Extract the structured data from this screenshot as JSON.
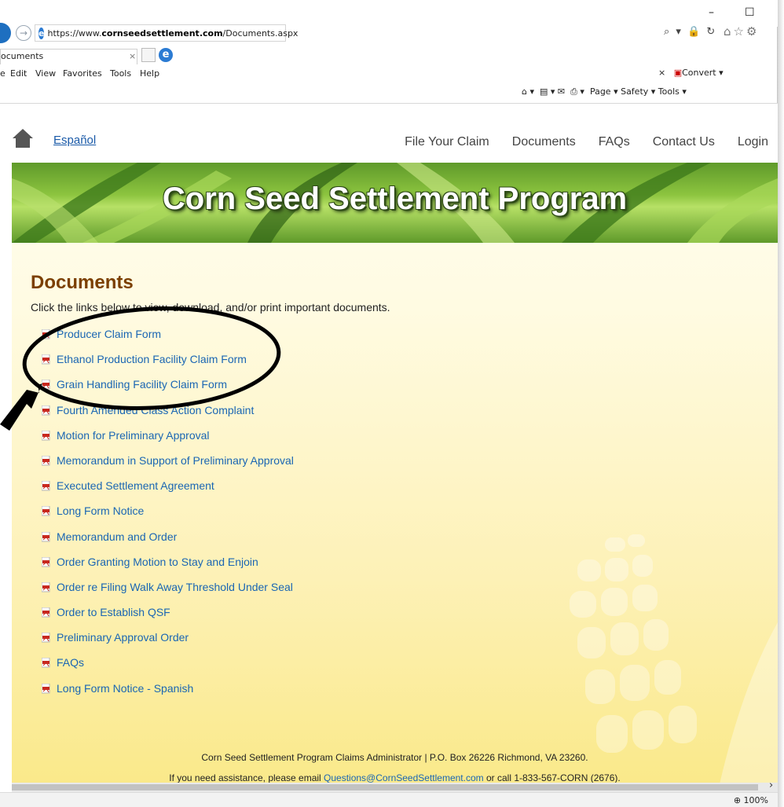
{
  "browser": {
    "url_prefix": "https://www.",
    "url_domain": "cornseedsettlement.com",
    "url_path": "/Documents.aspx",
    "address_right_icons": "⌕ ▾ 🔒 ↻",
    "tab_title": "ocuments",
    "tab_close": "×",
    "window_min": "–",
    "window_max": "☐",
    "menu": [
      "e",
      "Edit",
      "View",
      "Favorites",
      "Tools",
      "Help"
    ],
    "convert_close": "×",
    "convert_label": "Convert",
    "command_bar": "Page ▾   Safety ▾   Tools ▾",
    "zoom": "100%"
  },
  "site": {
    "espanol": "Español",
    "nav": [
      "File Your Claim",
      "Documents",
      "FAQs",
      "Contact Us",
      "Login"
    ],
    "banner_title": "Corn Seed Settlement Program"
  },
  "content": {
    "heading": "Documents",
    "intro": "Click the links below to view, download, and/or print important documents.",
    "documents": [
      "Producer Claim Form",
      "Ethanol Production Facility Claim Form",
      "Grain Handling Facility Claim Form",
      "Fourth Amended Class Action Complaint",
      "Motion for Preliminary Approval",
      "Memorandum in Support of Preliminary Approval",
      "Executed Settlement Agreement",
      "Long Form Notice",
      "Memorandum and Order",
      "Order Granting Motion to Stay and Enjoin",
      "Order re Filing Walk Away Threshold Under Seal",
      "Order to Establish QSF",
      "Preliminary Approval Order",
      "FAQs",
      "Long Form Notice - Spanish"
    ]
  },
  "footer": {
    "line1": "Corn Seed Settlement Program Claims Administrator | P.O. Box 26226 Richmond, VA 23260.",
    "line2_prefix": "If you need assistance, please email ",
    "line2_email": "Questions@CornSeedSettlement.com",
    "line2_suffix": " or call 1-833-567-CORN (2676)."
  },
  "colors": {
    "link": "#1a66b3",
    "heading": "#7b3f00",
    "banner_green": "#8cc43f",
    "page_yellow": "#fae98a"
  }
}
